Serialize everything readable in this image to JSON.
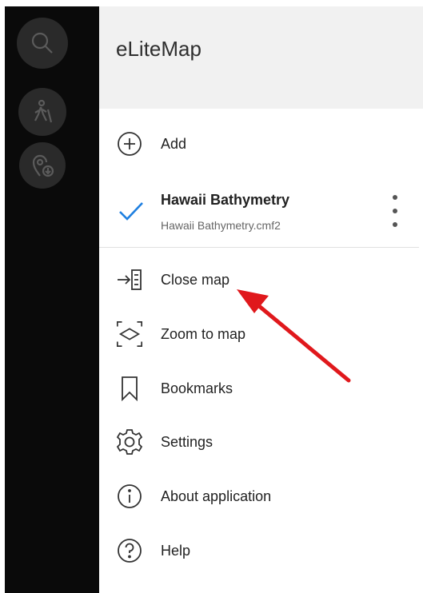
{
  "app": {
    "title": "eLiteMap"
  },
  "side_buttons": [
    {
      "icon": "search-icon"
    },
    {
      "icon": "pedestrian-icon"
    },
    {
      "icon": "location-download-icon"
    }
  ],
  "menu": {
    "add": {
      "label": "Add",
      "icon": "plus-circle-icon"
    },
    "current_map": {
      "title": "Hawaii Bathymetry",
      "file": "Hawaii Bathymetry.cmf2",
      "checked": true,
      "check_color": "#1e7fe0",
      "more_icon": "more-vertical-icon"
    },
    "items": [
      {
        "label": "Close map",
        "icon": "close-map-icon"
      },
      {
        "label": "Zoom to map",
        "icon": "zoom-to-map-icon"
      },
      {
        "label": "Bookmarks",
        "icon": "bookmark-icon"
      },
      {
        "label": "Settings",
        "icon": "settings-icon"
      },
      {
        "label": "About application",
        "icon": "info-icon"
      },
      {
        "label": "Help",
        "icon": "help-icon"
      }
    ]
  },
  "annotation": {
    "type": "arrow",
    "color": "#e0181c",
    "points_to": "Close map"
  }
}
